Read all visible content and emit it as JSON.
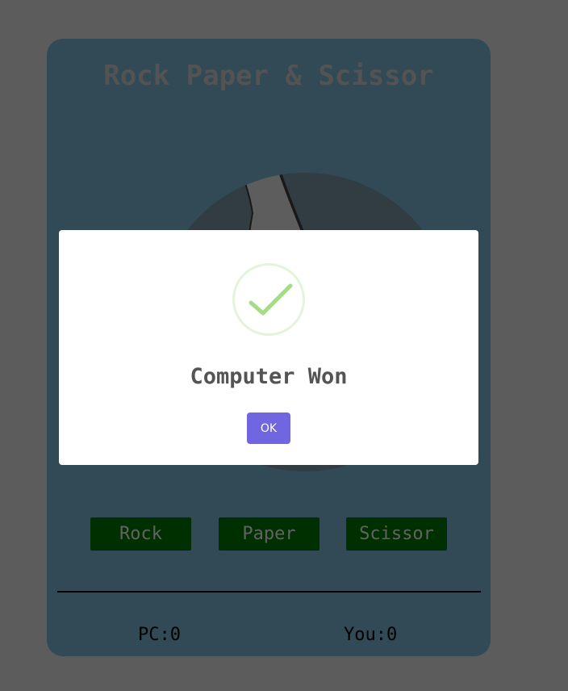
{
  "game": {
    "title": "Rock Paper & Scissor",
    "hand_image": "hand-illustration",
    "choices": [
      {
        "label": "Rock"
      },
      {
        "label": "Paper"
      },
      {
        "label": "Scissor"
      }
    ],
    "score": {
      "pc": "PC:0",
      "you": "You:0"
    }
  },
  "modal": {
    "icon": "success-check-icon",
    "title": "Computer Won",
    "confirm_label": "OK"
  },
  "colors": {
    "page_background": "#999999",
    "card_background": "#527c8e",
    "choice_button": "#005000",
    "confirm_button": "#7066e0",
    "success_check": "#a5dc86"
  }
}
